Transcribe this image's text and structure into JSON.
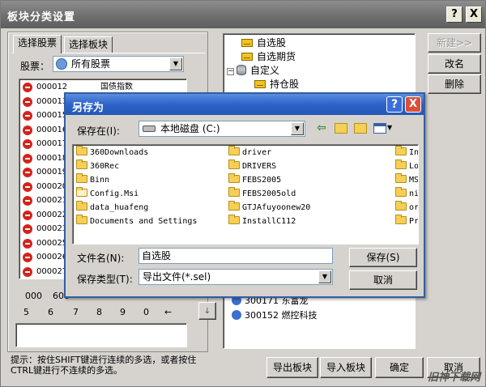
{
  "window": {
    "title": "板块分类设置",
    "help_glyph": "?",
    "close_glyph": "X"
  },
  "tabs": [
    "选择股票",
    "选择板块"
  ],
  "stock_filter": {
    "label": "股票：",
    "value": "所有股票"
  },
  "stock_list": [
    {
      "code": "000012",
      "name": "国债指数"
    },
    {
      "code": "000013",
      "name": ""
    },
    {
      "code": "000015",
      "name": ""
    },
    {
      "code": "000016",
      "name": ""
    },
    {
      "code": "000017",
      "name": ""
    },
    {
      "code": "000018",
      "name": ""
    },
    {
      "code": "000019",
      "name": ""
    },
    {
      "code": "000020",
      "name": ""
    },
    {
      "code": "000021",
      "name": ""
    },
    {
      "code": "000022",
      "name": ""
    },
    {
      "code": "000023",
      "name": ""
    },
    {
      "code": "000025",
      "name": ""
    },
    {
      "code": "000026",
      "name": ""
    },
    {
      "code": "000027",
      "name": ""
    }
  ],
  "keypad": {
    "row1": [
      "000",
      "600"
    ],
    "row2": [
      "5",
      "6",
      "7",
      "8",
      "9",
      "0",
      "←"
    ]
  },
  "hint": {
    "line1": "提示：按住SHIFT键进行连续的多选，或者按住",
    "line2": "CTRL键进行不连续的多选。"
  },
  "side_buttons": {
    "new": "新建>>",
    "rename": "改名",
    "delete": "删除"
  },
  "tree": {
    "items": [
      "自选股",
      "自选期货",
      "自定义",
      "持仓股"
    ]
  },
  "right_list": [
    {
      "code": "300171",
      "name": "东富龙"
    },
    {
      "code": "300152",
      "name": "燃控科技"
    }
  ],
  "bottom_buttons": {
    "export": "导出板块",
    "import": "导入板块",
    "ok": "确定",
    "cancel": "取消"
  },
  "save_dialog": {
    "title": "另存为",
    "help_glyph": "?",
    "close_glyph": "X",
    "save_in_label": "保存在(I):",
    "save_in_value": "本地磁盘 (C:)",
    "files_col1": [
      "360Downloads",
      "360Rec",
      "Binn",
      "Config.Msi",
      "data_huafeng",
      "Documents and Settings"
    ],
    "files_col2": [
      "driver",
      "DRIVERS",
      "FEBS2005",
      "FEBS2005old",
      "GTJAfuyoonew20",
      "InstallC112"
    ],
    "files_col3": [
      "Int",
      "Lot",
      "MSO",
      "niu",
      "ora",
      "Pro"
    ],
    "filename_label": "文件名(N):",
    "filename_value": "自选股",
    "filetype_label": "保存类型(T):",
    "filetype_value": "导出文件(*.sel)",
    "save_button": "保存(S)",
    "cancel_button": "取消"
  },
  "watermark": "旧神下载网"
}
